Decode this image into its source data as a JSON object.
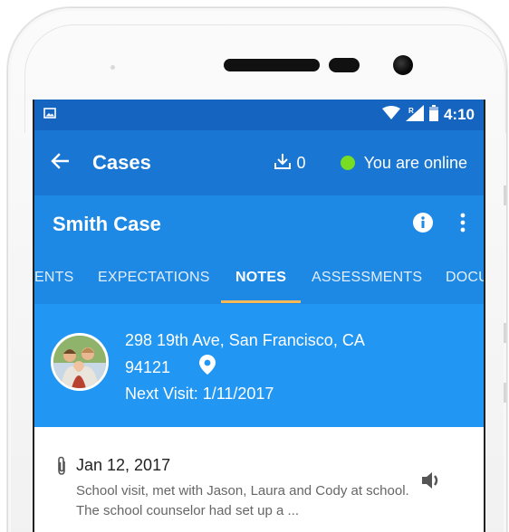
{
  "status_bar": {
    "time": "4:10",
    "icons": [
      "image-icon",
      "wifi-icon",
      "signal-icon",
      "battery-icon"
    ]
  },
  "app_bar": {
    "title": "Cases",
    "download_count": "0",
    "online_text": "You are online",
    "online_color": "#76dd23"
  },
  "case": {
    "name": "Smith Case"
  },
  "tabs": [
    {
      "label": "ENTS",
      "active": false
    },
    {
      "label": "EXPECTATIONS",
      "active": false
    },
    {
      "label": "NOTES",
      "active": true
    },
    {
      "label": "ASSESSMENTS",
      "active": false
    },
    {
      "label": "DOCU",
      "active": false
    }
  ],
  "header": {
    "address_line1": "298 19th Ave, San Francisco, CA",
    "address_line2": "94121",
    "next_visit": "Next Visit: 1/11/2017"
  },
  "notes": [
    {
      "date": "Jan 12, 2017",
      "text": "School visit, met with Jason, Laura and Cody at school. The school counselor had set up a ..."
    }
  ],
  "colors": {
    "status_bar": "#1565c0",
    "app_bar": "#1976d2",
    "case_bar": "#1e88e5",
    "header": "#2196f3",
    "tab_indicator": "#f7b955"
  }
}
